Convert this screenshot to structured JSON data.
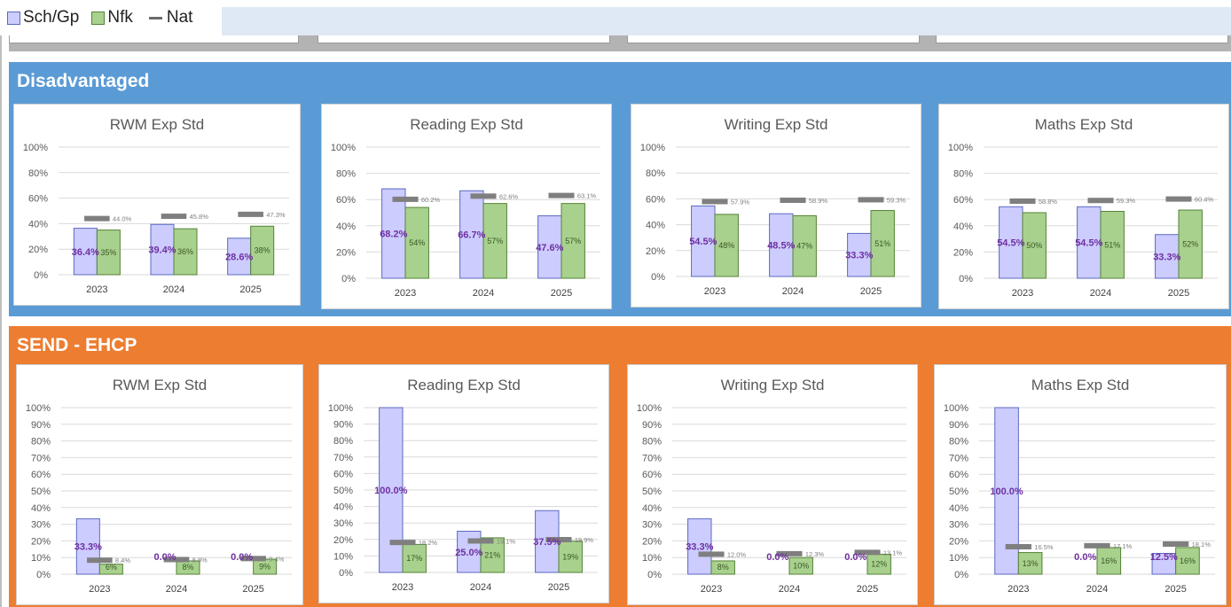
{
  "legend": [
    {
      "label": "Sch/Gp",
      "color": "#ccccff"
    },
    {
      "label": "Nfk",
      "color": "#a9d18e"
    },
    {
      "label": "Nat",
      "color": "#7f7f7f"
    }
  ],
  "colors": {
    "disadvantaged_bg": "#5b9bd5",
    "send_bg": "#ed7d31",
    "sch_fill": "#ccccff",
    "sch_border": "#5b6abf",
    "nfk_fill": "#a9d18e",
    "nfk_border": "#548235",
    "nat": "#7f7f7f",
    "sch_label": "#7030a0"
  },
  "sections": [
    {
      "title": "Disadvantaged"
    },
    {
      "title": "SEND - EHCP"
    }
  ],
  "chart_data": [
    {
      "section": "Disadvantaged",
      "type": "bar",
      "title": "RWM Exp Std",
      "categories": [
        "2023",
        "2024",
        "2025"
      ],
      "ylim": [
        0,
        100
      ],
      "yticks": [
        0,
        20,
        40,
        60,
        80,
        100
      ],
      "series": [
        {
          "name": "Sch/Gp",
          "values": [
            36.4,
            39.4,
            28.6
          ],
          "labels": [
            "36.4%",
            "39.4%",
            "28.6%"
          ]
        },
        {
          "name": "Nfk",
          "values": [
            35,
            36,
            38
          ],
          "labels": [
            "35%",
            "36%",
            "38%"
          ]
        },
        {
          "name": "Nat",
          "values": [
            44.0,
            45.8,
            47.3
          ],
          "labels": [
            "44.0%",
            "45.8%",
            "47.3%"
          ]
        }
      ]
    },
    {
      "section": "Disadvantaged",
      "type": "bar",
      "title": "Reading Exp Std",
      "categories": [
        "2023",
        "2024",
        "2025"
      ],
      "ylim": [
        0,
        100
      ],
      "yticks": [
        0,
        20,
        40,
        60,
        80,
        100
      ],
      "series": [
        {
          "name": "Sch/Gp",
          "values": [
            68.2,
            66.7,
            47.6
          ],
          "labels": [
            "68.2%",
            "66.7%",
            "47.6%"
          ]
        },
        {
          "name": "Nfk",
          "values": [
            54,
            57,
            57
          ],
          "labels": [
            "54%",
            "57%",
            "57%"
          ]
        },
        {
          "name": "Nat",
          "values": [
            60.2,
            62.6,
            63.1
          ],
          "labels": [
            "60.2%",
            "62.6%",
            "63.1%"
          ]
        }
      ]
    },
    {
      "section": "Disadvantaged",
      "type": "bar",
      "title": "Writing Exp Std",
      "categories": [
        "2023",
        "2024",
        "2025"
      ],
      "ylim": [
        0,
        100
      ],
      "yticks": [
        0,
        20,
        40,
        60,
        80,
        100
      ],
      "series": [
        {
          "name": "Sch/Gp",
          "values": [
            54.5,
            48.5,
            33.3
          ],
          "labels": [
            "54.5%",
            "48.5%",
            "33.3%"
          ]
        },
        {
          "name": "Nfk",
          "values": [
            48,
            47,
            51
          ],
          "labels": [
            "48%",
            "47%",
            "51%"
          ]
        },
        {
          "name": "Nat",
          "values": [
            57.9,
            58.9,
            59.3
          ],
          "labels": [
            "57.9%",
            "58.9%",
            "59.3%"
          ]
        }
      ]
    },
    {
      "section": "Disadvantaged",
      "type": "bar",
      "title": "Maths Exp Std",
      "categories": [
        "2023",
        "2024",
        "2025"
      ],
      "ylim": [
        0,
        100
      ],
      "yticks": [
        0,
        20,
        40,
        60,
        80,
        100
      ],
      "series": [
        {
          "name": "Sch/Gp",
          "values": [
            54.5,
            54.5,
            33.3
          ],
          "labels": [
            "54.5%",
            "54.5%",
            "33.3%"
          ]
        },
        {
          "name": "Nfk",
          "values": [
            50,
            51,
            52
          ],
          "labels": [
            "50%",
            "51%",
            "52%"
          ]
        },
        {
          "name": "Nat",
          "values": [
            58.8,
            59.3,
            60.4
          ],
          "labels": [
            "58.8%",
            "59.3%",
            "60.4%"
          ]
        }
      ]
    },
    {
      "section": "SEND - EHCP",
      "type": "bar",
      "title": "RWM Exp Std",
      "categories": [
        "2023",
        "2024",
        "2025"
      ],
      "ylim": [
        0,
        100
      ],
      "yticks": [
        0,
        10,
        20,
        30,
        40,
        50,
        60,
        70,
        80,
        90,
        100
      ],
      "series": [
        {
          "name": "Sch/Gp",
          "values": [
            33.3,
            0.0,
            0.0
          ],
          "labels": [
            "33.3%",
            "0.0%",
            "0.0%"
          ]
        },
        {
          "name": "Nfk",
          "values": [
            6,
            8,
            9
          ],
          "labels": [
            "6%",
            "8%",
            "9%"
          ]
        },
        {
          "name": "Nat",
          "values": [
            8.4,
            8.8,
            9.4
          ],
          "labels": [
            "8.4%",
            "8.8%",
            "9.4%"
          ]
        }
      ]
    },
    {
      "section": "SEND - EHCP",
      "type": "bar",
      "title": "Reading Exp Std",
      "categories": [
        "2023",
        "2024",
        "2025"
      ],
      "ylim": [
        0,
        100
      ],
      "yticks": [
        0,
        10,
        20,
        30,
        40,
        50,
        60,
        70,
        80,
        90,
        100
      ],
      "series": [
        {
          "name": "Sch/Gp",
          "values": [
            100.0,
            25.0,
            37.5
          ],
          "labels": [
            "100.0%",
            "25.0%",
            "37.5%"
          ]
        },
        {
          "name": "Nfk",
          "values": [
            17,
            21,
            19
          ],
          "labels": [
            "17%",
            "21%",
            "19%"
          ]
        },
        {
          "name": "Nat",
          "values": [
            18.2,
            19.1,
            19.9
          ],
          "labels": [
            "18.2%",
            "19.1%",
            "19.9%"
          ]
        }
      ]
    },
    {
      "section": "SEND - EHCP",
      "type": "bar",
      "title": "Writing Exp Std",
      "categories": [
        "2023",
        "2024",
        "2025"
      ],
      "ylim": [
        0,
        100
      ],
      "yticks": [
        0,
        10,
        20,
        30,
        40,
        50,
        60,
        70,
        80,
        90,
        100
      ],
      "series": [
        {
          "name": "Sch/Gp",
          "values": [
            33.3,
            0.0,
            0.0
          ],
          "labels": [
            "33.3%",
            "0.0%",
            "0.0%"
          ]
        },
        {
          "name": "Nfk",
          "values": [
            8,
            10,
            12
          ],
          "labels": [
            "8%",
            "10%",
            "12%"
          ]
        },
        {
          "name": "Nat",
          "values": [
            12.0,
            12.3,
            13.1
          ],
          "labels": [
            "12.0%",
            "12.3%",
            "13.1%"
          ]
        }
      ]
    },
    {
      "section": "SEND - EHCP",
      "type": "bar",
      "title": "Maths Exp Std",
      "categories": [
        "2023",
        "2024",
        "2025"
      ],
      "ylim": [
        0,
        100
      ],
      "yticks": [
        0,
        10,
        20,
        30,
        40,
        50,
        60,
        70,
        80,
        90,
        100
      ],
      "series": [
        {
          "name": "Sch/Gp",
          "values": [
            100.0,
            0.0,
            12.5
          ],
          "labels": [
            "100.0%",
            "0.0%",
            "12.5%"
          ]
        },
        {
          "name": "Nfk",
          "values": [
            13,
            16,
            16
          ],
          "labels": [
            "13%",
            "16%",
            "16%"
          ]
        },
        {
          "name": "Nat",
          "values": [
            16.5,
            17.1,
            18.1
          ],
          "labels": [
            "16.5%",
            "17.1%",
            "18.1%"
          ]
        }
      ]
    }
  ]
}
